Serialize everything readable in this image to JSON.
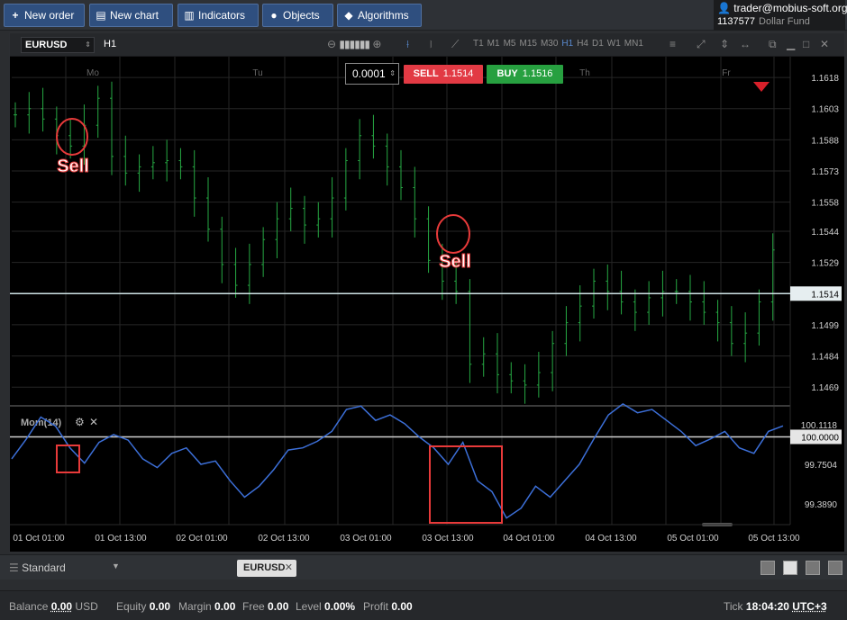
{
  "toolbar": {
    "new_order": "New order",
    "new_chart": "New chart",
    "indicators": "Indicators",
    "objects": "Objects",
    "algorithms": "Algorithms"
  },
  "account": {
    "user": "trader@mobius-soft.org",
    "number": "1137577",
    "fund": "Dollar Fund"
  },
  "chart": {
    "symbol": "EURUSD",
    "timeframe": "H1",
    "timeframes": [
      "T1",
      "M1",
      "M5",
      "M15",
      "M30",
      "H1",
      "H4",
      "D1",
      "W1",
      "MN1"
    ],
    "active_timeframe": "H1",
    "quantity": "0.0001",
    "sell_label": "SELL",
    "sell_price": "1.1514",
    "buy_label": "BUY",
    "buy_price": "1.1516",
    "day_labels": [
      "Mo",
      "Tu",
      "Th",
      "Fr"
    ],
    "price_ticks": [
      "1.1618",
      "1.1603",
      "1.1588",
      "1.1573",
      "1.1558",
      "1.1544",
      "1.1529",
      "1.1499",
      "1.1484",
      "1.1469"
    ],
    "current_price": "1.1514",
    "annotation_text": "Sell",
    "indicator_name": "Mom(14)",
    "indicator_ticks": [
      "100.1118",
      "99.7504",
      "99.3890"
    ],
    "indicator_level": "100.0000",
    "time_labels": [
      "01 Oct 01:00",
      "01 Oct 13:00",
      "02 Oct 01:00",
      "02 Oct 13:00",
      "03 Oct 01:00",
      "03 Oct 13:00",
      "04 Oct 01:00",
      "04 Oct 13:00",
      "05 Oct 01:00",
      "05 Oct 13:00"
    ],
    "colors": {
      "candles": "#26a843",
      "momentum": "#3c6fd8",
      "annotation": "#e83a3a",
      "sell": "#e23a44",
      "buy": "#27a040"
    }
  },
  "chart_data": {
    "type": "line",
    "price_series": {
      "name": "EURUSD",
      "time_range": [
        "01 Oct 01:00",
        "05 Oct 13:00"
      ],
      "ylim": [
        1.146,
        1.1628
      ],
      "close_approx": [
        1.16,
        1.1603,
        1.1598,
        1.159,
        1.1585,
        1.1595,
        1.1608,
        1.158,
        1.1572,
        1.1575,
        1.1577,
        1.1578,
        1.1575,
        1.156,
        1.1545,
        1.1528,
        1.1518,
        1.1528,
        1.154,
        1.155,
        1.1555,
        1.1547,
        1.155,
        1.156,
        1.1578,
        1.159,
        1.1585,
        1.1575,
        1.1565,
        1.155,
        1.153,
        1.152,
        1.1515,
        1.148,
        1.1485,
        1.1475,
        1.1472,
        1.147,
        1.1476,
        1.149,
        1.15,
        1.1508,
        1.152,
        1.1515,
        1.151,
        1.1505,
        1.1512,
        1.1515,
        1.1515,
        1.151,
        1.1505,
        1.15,
        1.149,
        1.1495,
        1.151,
        1.1535
      ]
    },
    "momentum_series": {
      "name": "Mom(14)",
      "ylim": [
        99.2,
        100.25
      ],
      "level": 100.0,
      "values_approx": [
        99.8,
        99.98,
        100.18,
        100.1,
        99.9,
        99.76,
        99.95,
        100.02,
        99.97,
        99.8,
        99.72,
        99.85,
        99.9,
        99.75,
        99.78,
        99.6,
        99.45,
        99.55,
        99.7,
        99.88,
        99.9,
        99.96,
        100.05,
        100.25,
        100.28,
        100.15,
        100.2,
        100.12,
        100.0,
        99.9,
        99.75,
        99.95,
        99.6,
        99.5,
        99.26,
        99.35,
        99.55,
        99.45,
        99.6,
        99.75,
        99.98,
        100.2,
        100.3,
        100.22,
        100.25,
        100.15,
        100.05,
        99.92,
        99.98,
        100.05,
        99.9,
        99.85,
        100.05,
        100.1
      ]
    }
  },
  "bottom": {
    "workspace": "Standard",
    "tab_symbol": "EURUSD"
  },
  "status": {
    "balance_label": "Balance",
    "balance_value": "0.00",
    "currency": "USD",
    "equity_label": "Equity",
    "equity_value": "0.00",
    "margin_label": "Margin",
    "margin_value": "0.00",
    "free_label": "Free",
    "free_value": "0.00",
    "level_label": "Level",
    "level_value": "0.00%",
    "profit_label": "Profit",
    "profit_value": "0.00",
    "tick_label": "Tick",
    "tick_time": "18:04:20",
    "timezone": "UTC+3"
  }
}
